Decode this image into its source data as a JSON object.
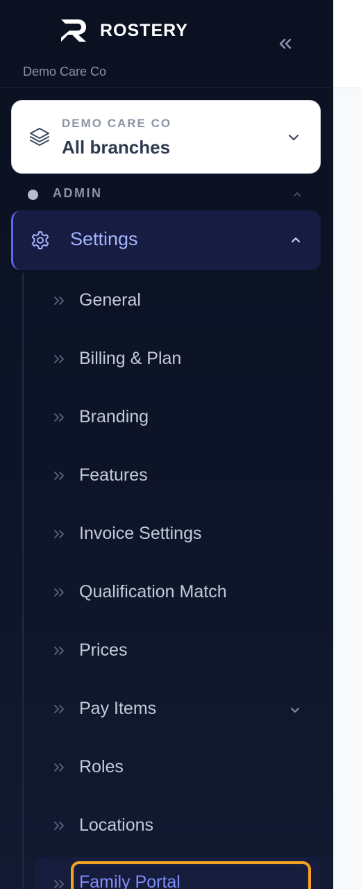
{
  "app": {
    "brand": "ROSTERY",
    "org_subtitle": "Demo Care Co"
  },
  "branch_selector": {
    "label": "DEMO CARE CO",
    "value": "All branches",
    "icon": "layers-icon"
  },
  "nav": {
    "section_label": "ADMIN",
    "settings": {
      "label": "Settings",
      "icon": "gear-icon",
      "expanded": true,
      "children": [
        {
          "label": "General"
        },
        {
          "label": "Billing & Plan"
        },
        {
          "label": "Branding"
        },
        {
          "label": "Features"
        },
        {
          "label": "Invoice Settings"
        },
        {
          "label": "Qualification Match"
        },
        {
          "label": "Prices"
        },
        {
          "label": "Pay Items",
          "has_submenu": true
        },
        {
          "label": "Roles"
        },
        {
          "label": "Locations"
        },
        {
          "label": "Family Portal",
          "active": true
        }
      ]
    }
  },
  "colors": {
    "sidebar_bg": "#0d1428",
    "accent": "#818cf8",
    "focus_ring": "#f4a124"
  }
}
